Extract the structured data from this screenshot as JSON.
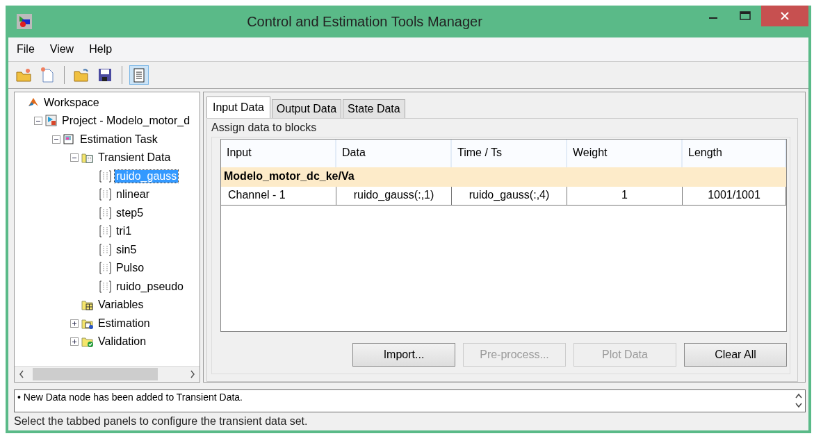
{
  "window": {
    "title": "Control and Estimation Tools Manager"
  },
  "menu": [
    "File",
    "View",
    "Help"
  ],
  "tree": [
    {
      "label": "Workspace",
      "kind": "workspace",
      "selected": false,
      "children": [
        {
          "label": "Project - Modelo_motor_d",
          "kind": "project",
          "expanded": true,
          "selected": false,
          "children": [
            {
              "label": "Estimation Task",
              "kind": "task",
              "expanded": true,
              "selected": false,
              "children": [
                {
                  "label": "Transient Data",
                  "kind": "datafolder",
                  "expanded": true,
                  "selected": false,
                  "children": [
                    {
                      "label": "ruido_gauss",
                      "kind": "data",
                      "selected": true
                    },
                    {
                      "label": "nlinear",
                      "kind": "data",
                      "selected": false
                    },
                    {
                      "label": "step5",
                      "kind": "data",
                      "selected": false
                    },
                    {
                      "label": "tri1",
                      "kind": "data",
                      "selected": false
                    },
                    {
                      "label": "sin5",
                      "kind": "data",
                      "selected": false
                    },
                    {
                      "label": "Pulso",
                      "kind": "data",
                      "selected": false
                    },
                    {
                      "label": "ruido_pseudo",
                      "kind": "data",
                      "selected": false
                    }
                  ]
                },
                {
                  "label": "Variables",
                  "kind": "varfolder",
                  "selected": false
                },
                {
                  "label": "Estimation",
                  "kind": "estfolder",
                  "expanded": false,
                  "selected": false
                },
                {
                  "label": "Validation",
                  "kind": "valfolder",
                  "expanded": false,
                  "selected": false
                }
              ]
            }
          ]
        }
      ]
    }
  ],
  "tabs": [
    {
      "label": "Input Data",
      "selected": true
    },
    {
      "label": "Output Data",
      "selected": false
    },
    {
      "label": "State Data",
      "selected": false
    }
  ],
  "group_title": "Assign data to blocks",
  "table": {
    "columns": [
      "Input",
      "Data",
      "Time / Ts",
      "Weight",
      "Length"
    ],
    "rows": [
      {
        "kind": "group",
        "cells": [
          "Modelo_motor_dc_ke/Va"
        ]
      },
      {
        "kind": "channel",
        "cells": [
          "Channel - 1",
          "ruido_gauss(:,1)",
          "ruido_gauss(:,4)",
          "1",
          "1001/1001"
        ]
      }
    ]
  },
  "buttons": [
    {
      "label": "Import...",
      "disabled": false
    },
    {
      "label": "Pre-process...",
      "disabled": true
    },
    {
      "label": "Plot Data",
      "disabled": true
    },
    {
      "label": "Clear All",
      "disabled": false
    }
  ],
  "log": "• New Data node has been added to Transient Data.",
  "status_bar": "Select the tabbed panels to configure the transient data set."
}
